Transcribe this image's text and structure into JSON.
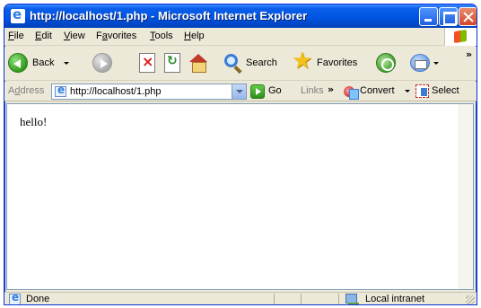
{
  "window": {
    "title": "http://localhost/1.php - Microsoft Internet Explorer"
  },
  "menu": {
    "items": [
      {
        "label": "File",
        "access": "F",
        "rest": "ile"
      },
      {
        "label": "Edit",
        "access": "E",
        "rest": "dit"
      },
      {
        "label": "View",
        "access": "V",
        "rest": "iew"
      },
      {
        "label": "Favorites",
        "access": "a",
        "pre": "F",
        "rest": "vorites"
      },
      {
        "label": "Tools",
        "access": "T",
        "rest": "ools"
      },
      {
        "label": "Help",
        "access": "H",
        "rest": "elp"
      }
    ]
  },
  "toolbar": {
    "back_label": "Back",
    "search_label": "Search",
    "favorites_label": "Favorites",
    "more_glyph": "»"
  },
  "address": {
    "label_access": "d",
    "label_pre": "A",
    "label_rest": "dress",
    "value": "http://localhost/1.php",
    "go_label": "Go",
    "links_label": "Links",
    "links_glyph": "»",
    "convert_label": "Convert",
    "select_label": "Select"
  },
  "content": {
    "text": "hello!"
  },
  "status": {
    "text": "Done",
    "zone": "Local intranet"
  }
}
